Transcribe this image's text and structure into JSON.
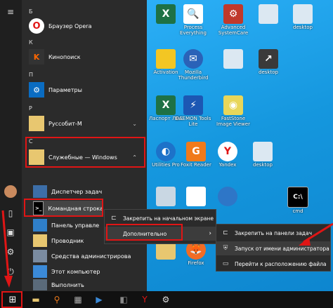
{
  "start_menu": {
    "letters": {
      "b": "Б",
      "k": "К",
      "p": "П",
      "r": "Р",
      "s": "С"
    },
    "apps": {
      "opera": "Браузер Opera",
      "kinopoisk": "Кинопоиск",
      "settings": "Параметры",
      "russobit": "Руссобит-М",
      "windows_tools": "Служебные — Windows",
      "task_manager": "Диспетчер задач",
      "cmd": "Командная строка",
      "control_panel": "Панель управле",
      "explorer": "Проводник",
      "admin_tools": "Средства администрирова",
      "this_pc": "Этот компьютер",
      "run": "Выполнить"
    }
  },
  "context_menu_1": {
    "pin_start": "Закрепить на начальном экране",
    "more": "Дополнительно"
  },
  "context_menu_2": {
    "pin_taskbar": "Закрепить на панели задач",
    "run_admin": "Запуск от имени администратора",
    "open_location": "Перейти к расположению файла"
  },
  "desktop": {
    "r1": [
      "",
      "Process Everything",
      "Advanced SystemCare",
      "",
      "desktop"
    ],
    "r2": [
      "Activation",
      "Mozilla Thunderbird",
      "",
      "desktop"
    ],
    "r3": [
      "Ласпорт ЛВС",
      "DAEMON Tools Lite",
      "FastStone Image Viewer"
    ],
    "r4": [
      "Utilities Pro",
      "Foxit Reader",
      "Yandex",
      "desktop"
    ],
    "r5": [
      "",
      "",
      "",
      "cmd"
    ],
    "r6": [
      "",
      "Firefox",
      ""
    ]
  },
  "colors": {
    "highlight": "#e01515",
    "accent": "#1aa3e6"
  }
}
